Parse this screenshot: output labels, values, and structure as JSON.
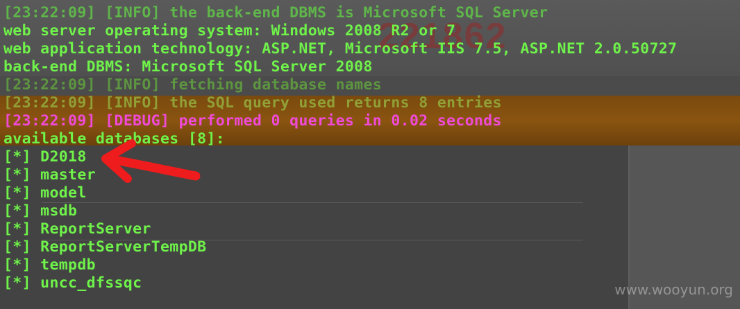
{
  "terminal": {
    "lines": [
      {
        "text": "[23:22:09] [INFO] the back-end DBMS is Microsoft SQL Server",
        "color": "#5fb64a"
      },
      {
        "text": "web server operating system: Windows 2008 R2 or 7",
        "color": "#6ff24a"
      },
      {
        "text": "web application technology: ASP.NET, Microsoft IIS 7.5, ASP.NET 2.0.50727",
        "color": "#6ff24a"
      },
      {
        "text": "back-end DBMS: Microsoft SQL Server 2008",
        "color": "#6ff24a"
      },
      {
        "text": "[23:22:09] [INFO] fetching database names",
        "color": "#5f9d40"
      },
      {
        "text": "[23:22:09] [INFO] the SQL query used returns 8 entries",
        "color": "#93a83a"
      },
      {
        "text": "[23:22:09] [DEBUG] performed 0 queries in 0.02 seconds",
        "color": "#f04ad8"
      },
      {
        "text": "available databases [8]:",
        "color": "#6ff24a"
      },
      {
        "text": "[*] D2018",
        "color": "#6ff24a"
      },
      {
        "text": "[*] master",
        "color": "#6ff24a"
      },
      {
        "text": "[*] model",
        "color": "#6ff24a"
      },
      {
        "text": "[*] msdb",
        "color": "#6ff24a"
      },
      {
        "text": "[*] ReportServer",
        "color": "#6ff24a"
      },
      {
        "text": "[*] ReportServerTempDB",
        "color": "#6ff24a"
      },
      {
        "text": "[*] tempdb",
        "color": "#6ff24a"
      },
      {
        "text": "[*] uncc_dfssqc",
        "color": "#6ff24a"
      }
    ]
  },
  "annotation": {
    "icon": "red-arrow-icon",
    "color": "#ee1c1c"
  },
  "watermark": "www.wooyun.org",
  "background": {
    "ghost_number": "221862"
  }
}
